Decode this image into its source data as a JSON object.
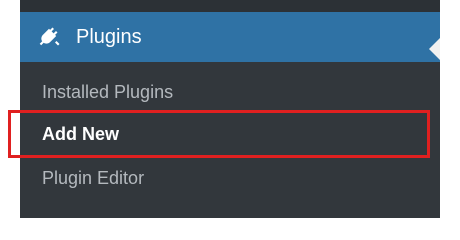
{
  "menu": {
    "active": {
      "label": "Plugins",
      "icon": "plugin-icon"
    },
    "submenu": {
      "items": [
        {
          "label": "Installed Plugins"
        },
        {
          "label": "Add New",
          "current": true
        },
        {
          "label": "Plugin Editor"
        }
      ]
    }
  },
  "colors": {
    "sidebar_bg": "#2c3136",
    "submenu_bg": "#32373c",
    "active_bg": "#2f72a5",
    "highlight_border": "#e02020",
    "submenu_text": "#b4b9be",
    "current_text": "#ffffff"
  }
}
